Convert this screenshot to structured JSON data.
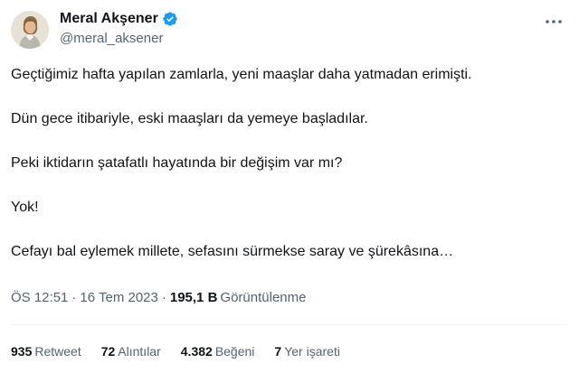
{
  "author": {
    "display_name": "Meral Akşener",
    "handle": "@meral_aksener"
  },
  "tweet": {
    "paragraphs": [
      "Geçtiğimiz hafta yapılan zamlarla, yeni maaşlar daha yatmadan erimişti.",
      "Dün gece itibariyle, eski maaşları da yemeye başladılar.",
      "Peki iktidarın şatafatlı hayatında bir değişim var mı?",
      "Yok!",
      "Cefayı bal eylemek millete, sefasını sürmekse saray ve şürekâsına…"
    ]
  },
  "meta": {
    "time": "ÖS 12:51",
    "date": "16 Tem 2023",
    "views_count": "195,1 B",
    "views_label": "Görüntülenme"
  },
  "stats": {
    "retweets": {
      "count": "935",
      "label": "Retweet"
    },
    "quotes": {
      "count": "72",
      "label": "Alıntılar"
    },
    "likes": {
      "count": "4.382",
      "label": "Beğeni"
    },
    "bookmarks": {
      "count": "7",
      "label": "Yer işareti"
    }
  },
  "colors": {
    "verified_badge": "#1d9bf0",
    "secondary_text": "#536471",
    "primary_text": "#0f1419"
  },
  "icons": {
    "verified": "verified-badge-icon",
    "more": "more-horizontal-icon"
  }
}
